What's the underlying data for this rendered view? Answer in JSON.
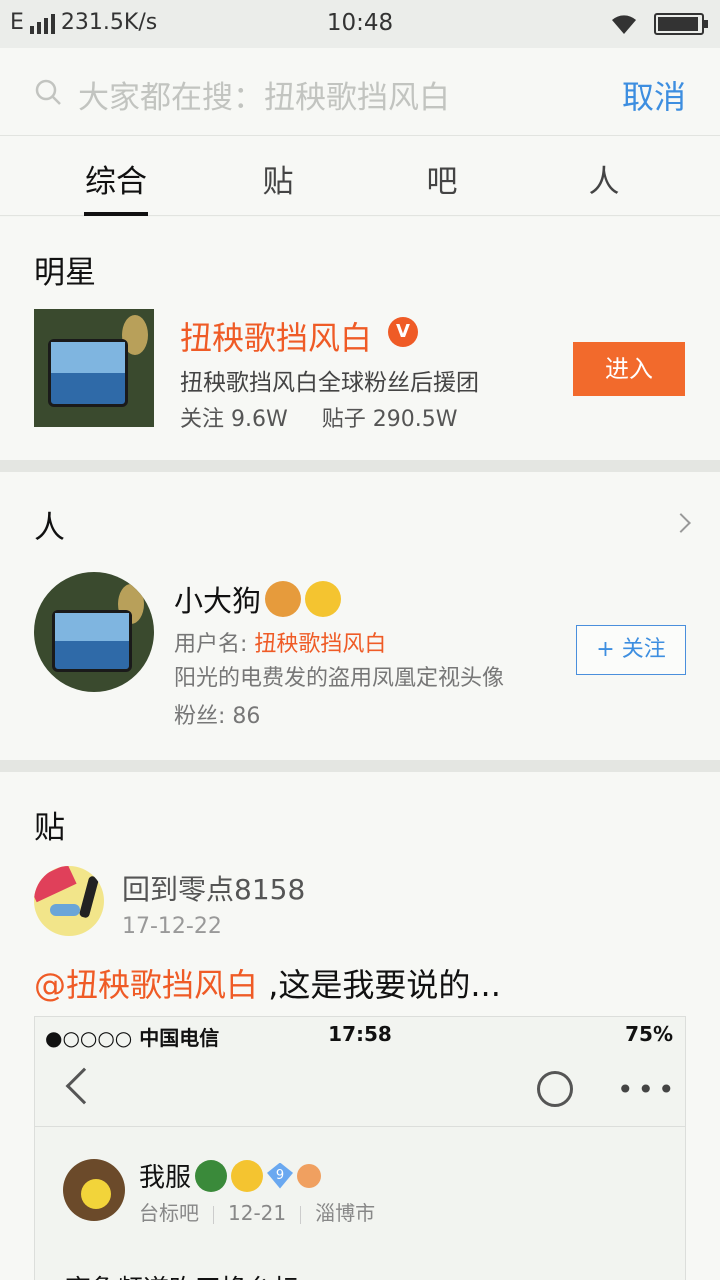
{
  "status_bar": {
    "network": "E",
    "speed": "231.5K/s",
    "time": "10:48"
  },
  "search": {
    "placeholder": "大家都在搜：扭秧歌挡风白",
    "cancel_label": "取消"
  },
  "tabs": [
    {
      "label": "综合",
      "active": true
    },
    {
      "label": "贴",
      "active": false
    },
    {
      "label": "吧",
      "active": false
    },
    {
      "label": "人",
      "active": false
    }
  ],
  "star_section": {
    "title": "明星",
    "name": "扭秧歌挡风白",
    "badge": "V",
    "description": "扭秧歌挡风白全球粉丝后援团",
    "followers": "关注 9.6W",
    "posts": "贴子 290.5W",
    "enter_label": "进入"
  },
  "people_section": {
    "title": "人",
    "name": "小大狗",
    "username_prefix": "用户名: ",
    "username": "扭秧歌挡风白",
    "bio": "阳光的电费发的盗用凤凰定视头像",
    "fans": "粉丝: 86",
    "follow_label": "+ 关注"
  },
  "post_section": {
    "title": "贴",
    "author": "回到零点8158",
    "date": "17-12-22",
    "mention": "@扭秧歌挡风白",
    "text": " ,这是我要说的...",
    "embedded": {
      "status_left": "●○○○○ 中国电信",
      "status_time": "17:58",
      "status_right": "75%",
      "author": "我服",
      "level": "9",
      "forum": "台标吧",
      "date": "12-21",
      "location": "淄博市",
      "body": "齐鲁频道昨天换台标"
    }
  }
}
